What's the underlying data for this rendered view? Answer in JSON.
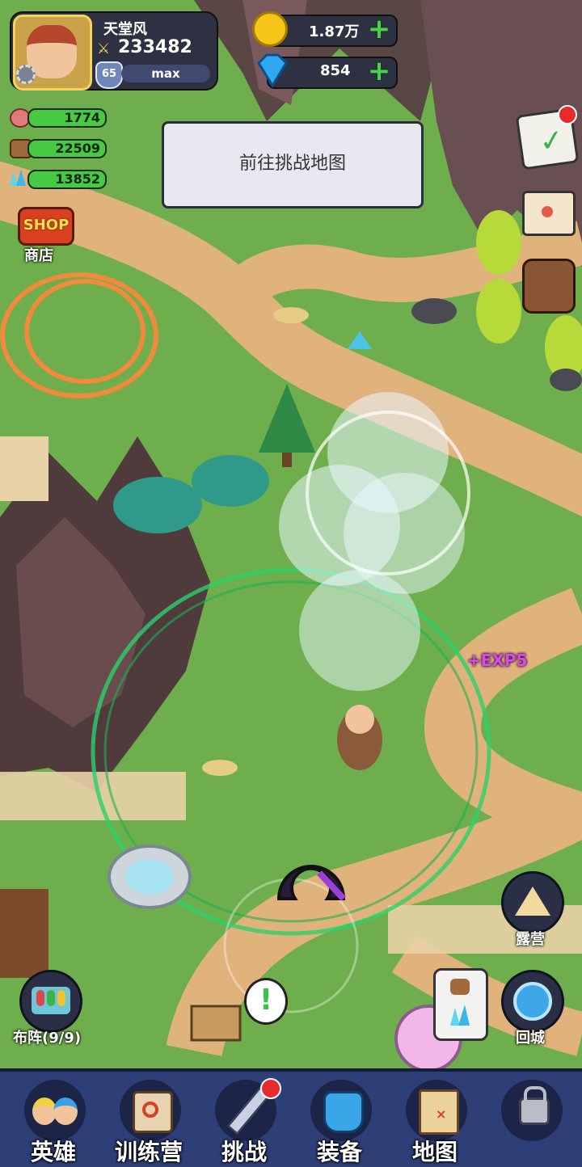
{
  "player": {
    "name": "天堂风",
    "power": "233482",
    "level": "65",
    "level_status": "max"
  },
  "currencies": {
    "gold": "1.87万",
    "diamond": "854"
  },
  "resources": [
    {
      "icon": "meat-icon",
      "value": "1774"
    },
    {
      "icon": "wood-icon",
      "value": "22509"
    },
    {
      "icon": "crystal-icon",
      "value": "13852"
    }
  ],
  "shop": {
    "badge": "SHOP",
    "label": "商店"
  },
  "prompt_button": "前往挑战地图",
  "floating_text": "+EXP5",
  "side_buttons": {
    "camp": "露营",
    "formation": "布阵(9/9)",
    "return_city": "回城"
  },
  "nav": [
    {
      "label": "英雄",
      "icon": "heroes-icon"
    },
    {
      "label": "训练营",
      "icon": "training-camp-icon"
    },
    {
      "label": "挑战",
      "icon": "challenge-sword-icon"
    },
    {
      "label": "装备",
      "icon": "equipment-armor-icon"
    },
    {
      "label": "地图",
      "icon": "map-icon"
    },
    {
      "label": "",
      "icon": "locked-icon"
    }
  ],
  "colors": {
    "grass": "#6fae4c",
    "path": "#e0b27c",
    "bar_fill": "#47c944",
    "nav_bg": "#2e3f78"
  }
}
